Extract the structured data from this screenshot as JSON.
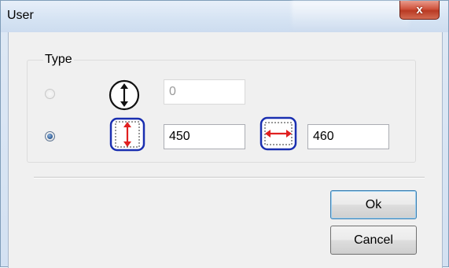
{
  "window": {
    "title": "User",
    "close_glyph": "x"
  },
  "group": {
    "label": "Type"
  },
  "rows": [
    {
      "selected": false,
      "enabled": false,
      "icon": "vertical-circle-arrow-icon",
      "value": "0"
    },
    {
      "selected": true,
      "enabled": true,
      "icon": "vertical-box-arrow-icon",
      "value": "450",
      "icon2": "horizontal-box-arrow-icon",
      "value2": "460"
    }
  ],
  "buttons": {
    "ok": "Ok",
    "cancel": "Cancel"
  },
  "colors": {
    "arrow_red": "#e02020",
    "frame_blue": "#1a2fb0",
    "close_red": "#c8432b"
  }
}
